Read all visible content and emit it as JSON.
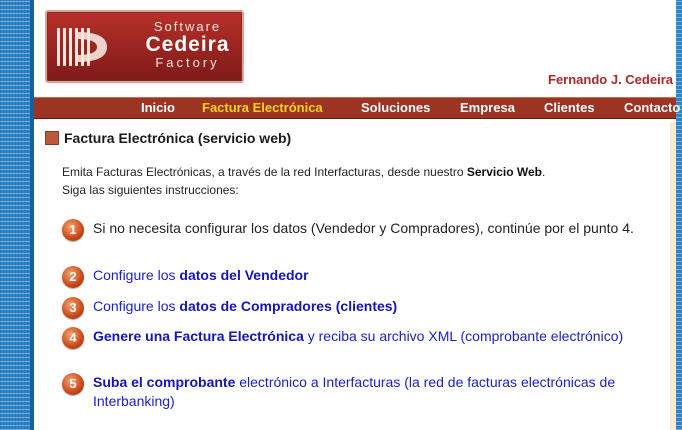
{
  "logo": {
    "line1": "Software",
    "line2": "Cedeira",
    "line3": "Factory"
  },
  "author": "Fernando J. Cedeira",
  "nav": {
    "items": [
      "Inicio",
      "Factura Electrónica",
      "Soluciones",
      "Empresa",
      "Clientes",
      "Contacto"
    ],
    "active_index": 1
  },
  "page": {
    "title": "Factura Electrónica (servicio web)",
    "intro_pre": "Emita Facturas Electrónicas, a través de la red Interfacturas, desde nuestro ",
    "intro_bold": "Servicio Web",
    "intro_post": ".",
    "intro_line2": "Siga las siguientes instrucciones:"
  },
  "steps": [
    {
      "number": "1",
      "text": "Si no necesita configurar los datos (Vendedor y Compradores), continúe por el punto 4."
    },
    {
      "number": "2",
      "pre": "Configure los ",
      "bold": "datos del Vendedor"
    },
    {
      "number": "3",
      "pre": "Configure los ",
      "bold": "datos de Compradores (clientes)"
    },
    {
      "number": "4",
      "bold": "Genere una Factura Electrónica",
      "post": " y reciba su archivo XML (comprobante electrónico)"
    },
    {
      "number": "5",
      "bold": "Suba el comprobante",
      "post": " electrónico a Interfacturas (la red de facturas electrónicas de Interbanking)"
    }
  ],
  "colors": {
    "nav_bg": "#9b3423",
    "nav_active": "#ffd21f",
    "link": "#1b22c4",
    "author": "#a52a2a",
    "side_strip": "#2e86c8"
  }
}
